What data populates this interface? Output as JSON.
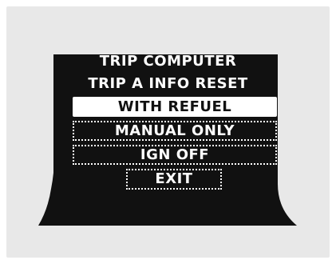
{
  "display": {
    "title": "TRIP COMPUTER",
    "subtitle": "TRIP A INFO RESET"
  },
  "menu": {
    "selected_index": 0,
    "items": [
      {
        "label": "WITH REFUEL"
      },
      {
        "label": "MANUAL ONLY"
      },
      {
        "label": "IGN OFF"
      },
      {
        "label": "EXIT"
      }
    ]
  },
  "colors": {
    "background": "#e8e8e8",
    "screen": "#111111",
    "text": "#ffffff",
    "highlight": "#ffffff"
  }
}
